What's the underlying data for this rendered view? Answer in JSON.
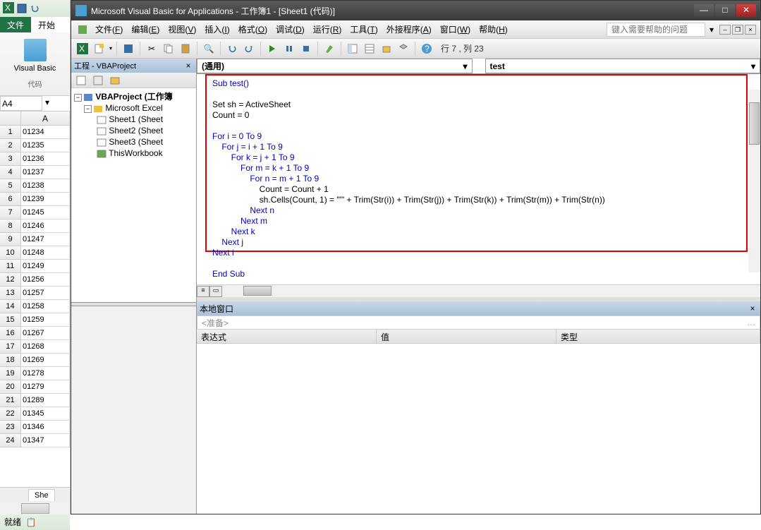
{
  "excel": {
    "tabs": {
      "file": "文件",
      "start": "开始"
    },
    "vb_label": "Visual Basic",
    "group_label": "代码",
    "namebox": "A4",
    "col_header": "A",
    "rows": [
      {
        "n": 1,
        "v": "01234"
      },
      {
        "n": 2,
        "v": "01235"
      },
      {
        "n": 3,
        "v": "01236"
      },
      {
        "n": 4,
        "v": "01237"
      },
      {
        "n": 5,
        "v": "01238"
      },
      {
        "n": 6,
        "v": "01239"
      },
      {
        "n": 7,
        "v": "01245"
      },
      {
        "n": 8,
        "v": "01246"
      },
      {
        "n": 9,
        "v": "01247"
      },
      {
        "n": 10,
        "v": "01248"
      },
      {
        "n": 11,
        "v": "01249"
      },
      {
        "n": 12,
        "v": "01256"
      },
      {
        "n": 13,
        "v": "01257"
      },
      {
        "n": 14,
        "v": "01258"
      },
      {
        "n": 15,
        "v": "01259"
      },
      {
        "n": 16,
        "v": "01267"
      },
      {
        "n": 17,
        "v": "01268"
      },
      {
        "n": 18,
        "v": "01269"
      },
      {
        "n": 19,
        "v": "01278"
      },
      {
        "n": 20,
        "v": "01279"
      },
      {
        "n": 21,
        "v": "01289"
      },
      {
        "n": 22,
        "v": "01345"
      },
      {
        "n": 23,
        "v": "01346"
      },
      {
        "n": 24,
        "v": "01347"
      }
    ],
    "sheet_tab": "She",
    "status": "就绪"
  },
  "vbe": {
    "title": "Microsoft Visual Basic for Applications - 工作簿1 - [Sheet1 (代码)]",
    "menus": [
      "文件(F)",
      "编辑(E)",
      "视图(V)",
      "插入(I)",
      "格式(O)",
      "调试(D)",
      "运行(R)",
      "工具(T)",
      "外接程序(A)",
      "窗口(W)",
      "帮助(H)"
    ],
    "help_placeholder": "键入需要帮助的问题",
    "cursor_status": "行 7 , 列 23",
    "project": {
      "title": "工程 - VBAProject",
      "root": "VBAProject (工作簿",
      "folder": "Microsoft Excel ",
      "items": [
        "Sheet1 (Sheet",
        "Sheet2 (Sheet",
        "Sheet3 (Sheet",
        "ThisWorkbook"
      ]
    },
    "dd_left": "(通用)",
    "dd_right": "test",
    "code": {
      "l01": "Sub test()",
      "l02": "",
      "l03": "Set sh = ActiveSheet",
      "l04": "Count = 0",
      "l05": "",
      "l06": "For i = 0 To 9",
      "l07": "    For j = i + 1 To 9",
      "l08": "        For k = j + 1 To 9",
      "l09": "            For m = k + 1 To 9",
      "l10": "                For n = m + 1 To 9",
      "l11": "                    Count = Count + 1",
      "l12a": "                    sh.Cells(Count, 1) = ",
      "l12b": "\"'\"",
      "l12c": " + Trim(Str(i)) + Trim(Str(j)) + Trim(Str(k)) + Trim(Str(m)) + Trim(Str(n))",
      "l13": "                Next n",
      "l14": "            Next m",
      "l15": "        Next k",
      "l16": "    Next j",
      "l17": "Next i",
      "l18": "",
      "l19": "End Sub"
    },
    "locals": {
      "title": "本地窗口",
      "ready": "<准备>",
      "cols": [
        "表达式",
        "值",
        "类型"
      ]
    }
  }
}
